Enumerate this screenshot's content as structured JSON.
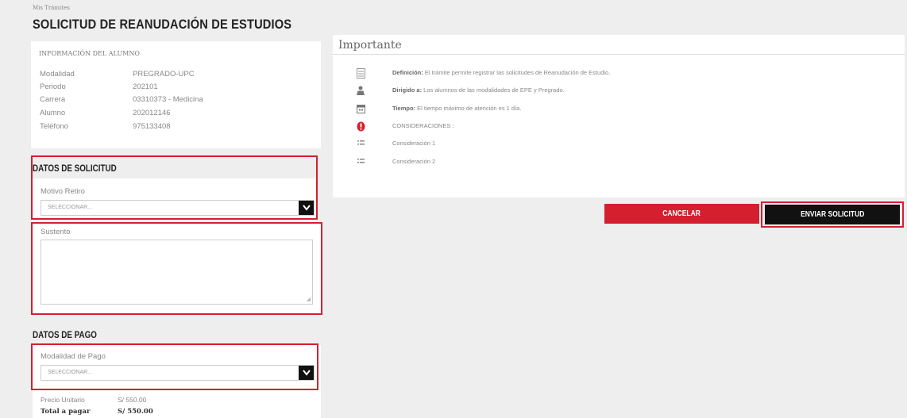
{
  "breadcrumb": "Mis Trámites",
  "page_title": "SOLICITUD DE REANUDACIÓN DE ESTUDIOS",
  "student_info": {
    "header": "INFORMACIÓN DEL ALUMNO",
    "rows": [
      {
        "label": "Modalidad",
        "value": "PREGRADO-UPC"
      },
      {
        "label": "Periodo",
        "value": "202101"
      },
      {
        "label": "Carrera",
        "value": "03310373 - Medicina"
      },
      {
        "label": "Alumno",
        "value": "202012146"
      },
      {
        "label": "Teléfono",
        "value": "975133408"
      }
    ]
  },
  "solicitud": {
    "section_title": "DATOS DE SOLICITUD",
    "motivo_label": "Motivo Retiro",
    "motivo_value": "SELECCIONAR...",
    "sustento_label": "Sustento",
    "sustento_value": ""
  },
  "pago": {
    "section_title": "DATOS DE PAGO",
    "modalidad_label": "Modalidad de Pago",
    "modalidad_value": "SELECCIONAR...",
    "precio_label": "Precio Unitario",
    "precio_value": "S/ 550.00",
    "total_label": "Total a pagar",
    "total_value": "S/ 550.00"
  },
  "importante": {
    "title": "Importante",
    "items": [
      {
        "icon": "document-icon",
        "bold": "Definición:",
        "text": " El trámite permite registrar las solicitudes de Reanudación de Estudio."
      },
      {
        "icon": "person-icon",
        "bold": "Dirigido a:",
        "text": " Los alumnos de las modalidades de EPE y Pregrado."
      },
      {
        "icon": "calendar-icon",
        "bold": "Tiempo:",
        "text": " El tiempo máximo de atención es 1 día."
      },
      {
        "icon": "alert-icon",
        "bold": "",
        "text": "CONSIDERACIONES :"
      },
      {
        "icon": "list-icon",
        "bold": "",
        "text": "Consideración 1"
      },
      {
        "icon": "list-icon",
        "bold": "",
        "text": "Consideración 2"
      }
    ]
  },
  "buttons": {
    "cancel": "CANCELAR",
    "submit": "ENVIAR SOLICITUD"
  },
  "colors": {
    "accent": "#d51f2f",
    "dark": "#111111"
  }
}
